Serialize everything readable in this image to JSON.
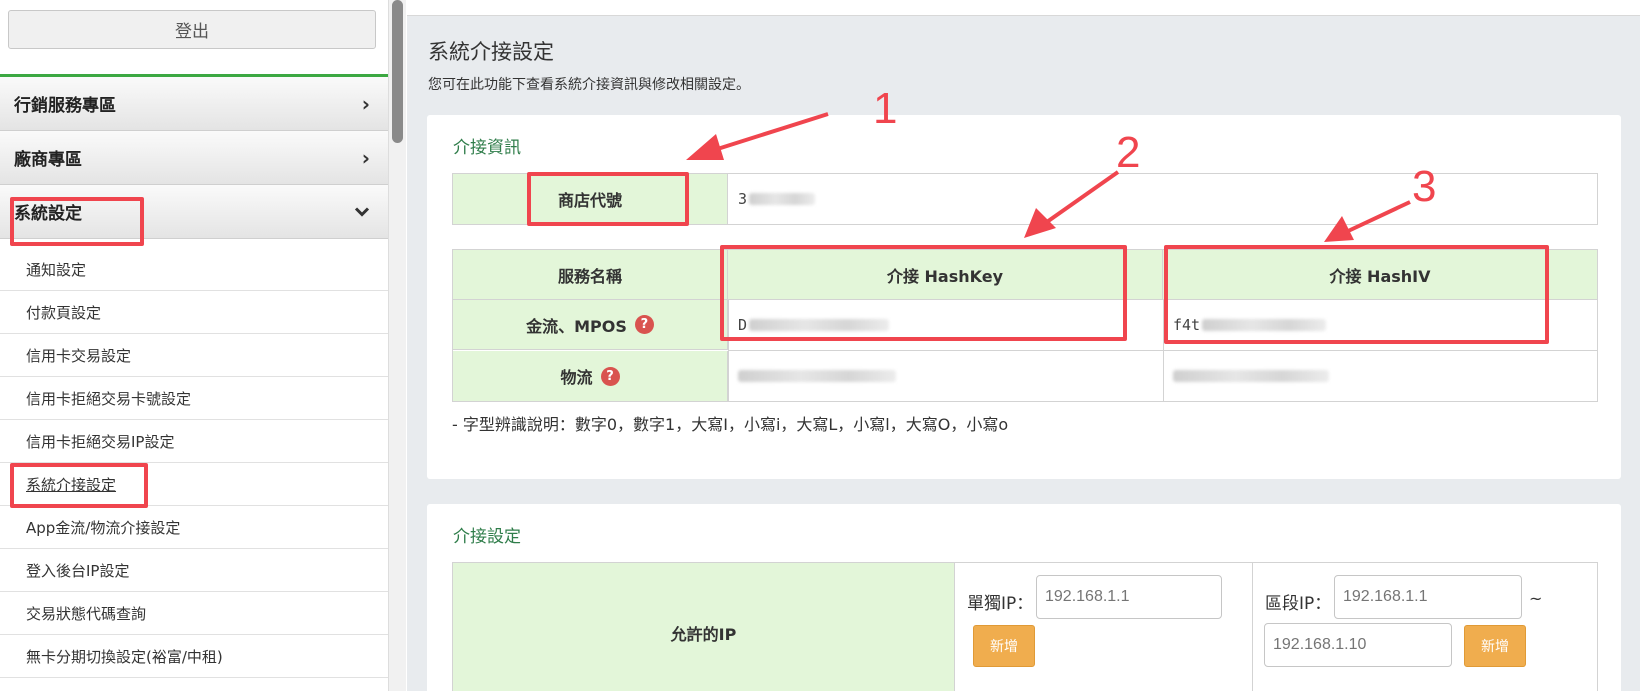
{
  "sidebar": {
    "logout_label": "登出",
    "sections": [
      {
        "label": "行銷服務專區",
        "chevron": "›"
      },
      {
        "label": "廠商專區",
        "chevron": "›"
      },
      {
        "label": "系統設定",
        "chevron": "⌄"
      }
    ],
    "sub_items": [
      "通知設定",
      "付款頁設定",
      "信用卡交易設定",
      "信用卡拒絕交易卡號設定",
      "信用卡拒絕交易IP設定",
      "系統介接設定",
      "App金流/物流介接設定",
      "登入後台IP設定",
      "交易狀態代碼查詢",
      "無卡分期切換設定(裕富/中租)"
    ],
    "active_item": "系統介接設定"
  },
  "main": {
    "title": "系統介接設定",
    "description": "您可在此功能下查看系統介接資訊與修改相關設定。",
    "info_panel": {
      "title": "介接資訊",
      "merchant_id_label": "商店代號",
      "merchant_id_value_visible": "3",
      "table_headers": [
        "服務名稱",
        "介接 HashKey",
        "介接 HashIV"
      ],
      "rows": [
        {
          "service": "金流、MPOS",
          "hashkey_visible": "D",
          "hashiv_visible": "f4t"
        },
        {
          "service": "物流",
          "hashkey_visible": "",
          "hashiv_visible": ""
        }
      ],
      "help_icon": "?",
      "font_note": "- 字型辨識說明：數字0，數字1，大寫I，小寫i，大寫L，小寫l，大寫O，小寫o"
    },
    "settings_panel": {
      "title": "介接設定",
      "allowed_ip_label": "允許的IP",
      "single_ip_label": "單獨IP：",
      "range_ip_label": "區段IP：",
      "range_separator": "~",
      "single_ip_placeholder": "192.168.1.1",
      "range_start_placeholder": "192.168.1.1",
      "range_end_placeholder": "192.168.1.10",
      "add_label": "新增"
    }
  },
  "annotations": {
    "numbers": [
      "1",
      "2",
      "3"
    ],
    "color": "#f0454e"
  },
  "colors": {
    "accent_green": "#3ca842",
    "header_green_bg": "#e3f6d9",
    "title_green": "#2f7d4a",
    "button_orange": "#f0ad4e",
    "help_red": "#d9534f"
  }
}
